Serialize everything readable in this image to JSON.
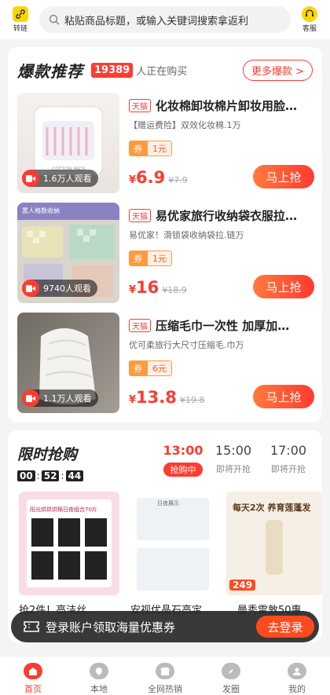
{
  "topbar": {
    "left_icon_label": "转链",
    "search_placeholder": "粘贴商品标题，或输入关键词搜索拿返利",
    "right_icon_label": "客服"
  },
  "hot": {
    "title": "爆款推荐",
    "count": "19389",
    "count_suffix": "人正在购买",
    "more_label": "更多爆款 >",
    "products": [
      {
        "platform": "天猫",
        "title": "化妆棉卸妆棉片卸妆用脸…",
        "desc": "【赠运费险】双效化妆棉.1万",
        "coupon_label": "券",
        "coupon_value": "1元",
        "currency": "¥",
        "price": "6.9",
        "orig": "¥7.9",
        "viewers": "1.6万人观看",
        "buy": "马上抢",
        "image_text": "COTTON PADS"
      },
      {
        "platform": "天猫",
        "title": "易优家旅行收纳袋衣服拉…",
        "desc": "易优家！滑锁袋收纳袋拉.链万",
        "coupon_label": "券",
        "coupon_value": "1元",
        "currency": "¥",
        "price": "16",
        "orig": "¥18.9",
        "viewers": "9740人观看",
        "buy": "马上抢",
        "image_text": "置人格数收纳"
      },
      {
        "platform": "天猫",
        "title": "压缩毛巾一次性 加厚加…",
        "desc": "优可柔旅行大尺寸压缩毛.巾万",
        "coupon_label": "券",
        "coupon_value": "6元",
        "currency": "¥",
        "price": "13.8",
        "orig": "¥19.8",
        "viewers": "1.1万人观看",
        "buy": "马上抢"
      }
    ]
  },
  "flash": {
    "title": "限时抢购",
    "timer": [
      "00",
      "52",
      "44"
    ],
    "slots": [
      {
        "time": "13:00",
        "status": "抢购中"
      },
      {
        "time": "15:00",
        "status": "即将开抢"
      },
      {
        "time": "17:00",
        "status": "即将开抢"
      }
    ],
    "items": [
      {
        "title": "抢2件！高洁丝…",
        "image_text": "阳光烘烘烘棉日夜组合70片"
      },
      {
        "title": "安视优晶石高定…",
        "image_text": "日夜展示"
      },
      {
        "title": "曼秀雷敦50惠…",
        "image_text": "每天2次 养育莲蓬发",
        "price": "249"
      }
    ]
  },
  "banner": {
    "text": "登录账户领取海量优惠券",
    "button": "去登录"
  },
  "tabs": [
    {
      "label": "首页",
      "active": true
    },
    {
      "label": "本地"
    },
    {
      "label": "全网热销"
    },
    {
      "label": "发圈"
    },
    {
      "label": "我的"
    }
  ],
  "colors": {
    "accent": "#ff3b30",
    "brand_yellow": "#ffd400",
    "coupon_orange": "#ff9a3d"
  }
}
